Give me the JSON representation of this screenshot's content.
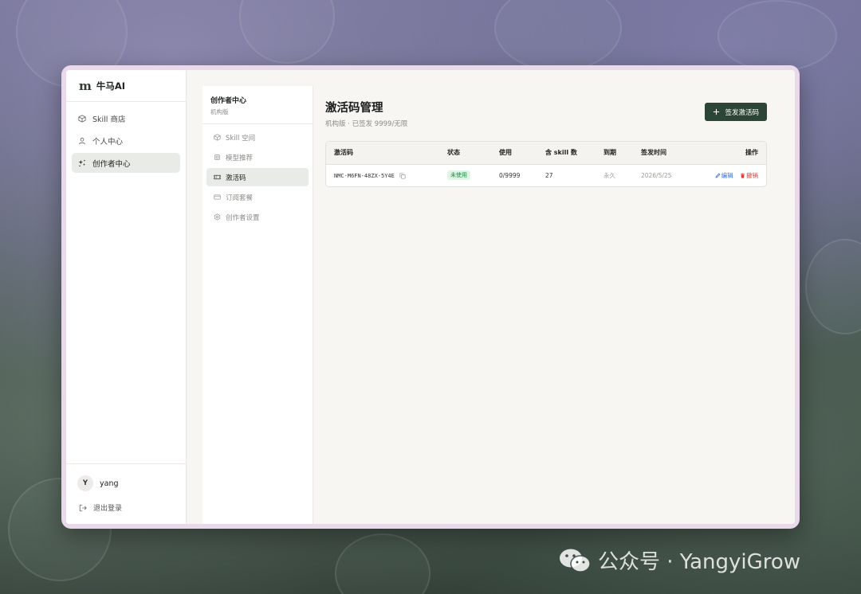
{
  "brand": {
    "logo_glyph": "m",
    "name": "牛马AI"
  },
  "sidebar": {
    "items": [
      {
        "label": "Skill 商店",
        "icon": "box-icon"
      },
      {
        "label": "个人中心",
        "icon": "user-icon"
      },
      {
        "label": "创作者中心",
        "icon": "sparkles-icon",
        "active": true
      }
    ],
    "user": {
      "avatar": "Y",
      "name": "yang"
    },
    "logout_label": "退出登录"
  },
  "subnav": {
    "title": "创作者中心",
    "subtitle": "机构版",
    "items": [
      {
        "label": "Skill 空间",
        "icon": "cube-icon"
      },
      {
        "label": "模型推荐",
        "icon": "chip-icon"
      },
      {
        "label": "激活码",
        "icon": "ticket-icon",
        "active": true
      },
      {
        "label": "订阅套餐",
        "icon": "card-icon"
      },
      {
        "label": "创作者设置",
        "icon": "settings-icon"
      }
    ]
  },
  "page": {
    "title": "激活码管理",
    "subtitle": "机构版 · 已签发 9999/无限",
    "primary_button": "签发激活码"
  },
  "table": {
    "headers": [
      "激活码",
      "状态",
      "使用",
      "含 skill 数",
      "到期",
      "签发时间",
      "操作"
    ],
    "rows": [
      {
        "code": "NMC-M6FN-48ZX-5Y4E",
        "status": "未使用",
        "usage": "0/9999",
        "skill_count": "27",
        "expiry": "永久",
        "issued": "2026/5/25",
        "edit": "编辑",
        "revoke": "撤销"
      }
    ]
  },
  "watermark": "公众号 · YangyiGrow",
  "colors": {
    "accent": "#2d4536",
    "badge_bg": "#dff5e5",
    "badge_text": "#1f8a42",
    "edit": "#2f6fdc",
    "revoke": "#d93b3b"
  }
}
